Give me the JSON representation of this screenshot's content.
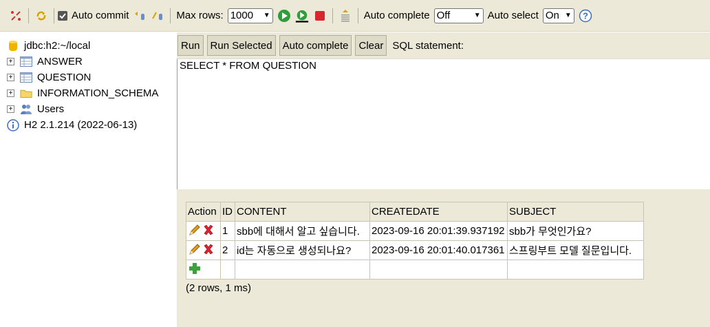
{
  "toolbar": {
    "auto_commit_label": "Auto commit",
    "max_rows_label": "Max rows:",
    "max_rows_value": "1000",
    "auto_complete_label": "Auto complete",
    "auto_complete_value": "Off",
    "auto_select_label": "Auto select",
    "auto_select_value": "On",
    "icons": [
      "disconnect-icon",
      "refresh-icon",
      "rollback-icon",
      "commit-icon",
      "run-icon",
      "run-selected-icon",
      "stop-icon",
      "history-icon",
      "help-icon"
    ]
  },
  "tree": {
    "connection": "jdbc:h2:~/local",
    "items": [
      {
        "label": "ANSWER",
        "icon": "table-icon"
      },
      {
        "label": "QUESTION",
        "icon": "table-icon"
      },
      {
        "label": "INFORMATION_SCHEMA",
        "icon": "folder-icon"
      },
      {
        "label": "Users",
        "icon": "users-icon"
      }
    ],
    "version": "H2 2.1.214 (2022-06-13)"
  },
  "buttons": {
    "run": "Run",
    "run_selected": "Run Selected",
    "auto_complete": "Auto complete",
    "clear": "Clear",
    "sql_label": "SQL statement:"
  },
  "sql": "SELECT * FROM QUESTION",
  "results": {
    "columns": [
      "Action",
      "ID",
      "CONTENT",
      "CREATEDATE",
      "SUBJECT"
    ],
    "rows": [
      {
        "id": "1",
        "content": "sbb에 대해서 알고 싶습니다.",
        "createdate": "2023-09-16 20:01:39.937192",
        "subject": "sbb가 무엇인가요?"
      },
      {
        "id": "2",
        "content": "id는 자동으로 생성되나요?",
        "createdate": "2023-09-16 20:01:40.017361",
        "subject": "스프링부트 모델 질문입니다."
      }
    ],
    "summary": "(2 rows, 1 ms)"
  },
  "colors": {
    "panel": "#ece9d8",
    "run_green": "#2e9e3a",
    "stop_red": "#d9262c",
    "delete_red": "#d23"
  }
}
